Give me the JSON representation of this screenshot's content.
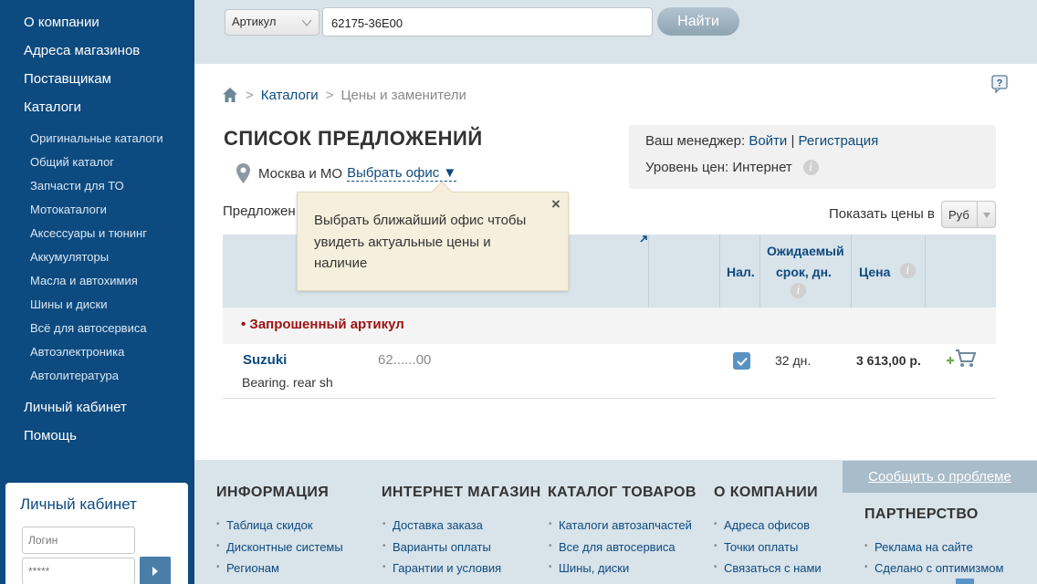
{
  "sidebar": {
    "main_top": [
      "О компании",
      "Адреса магазинов",
      "Поставщикам",
      "Каталоги"
    ],
    "sub": [
      "Оригинальные каталоги",
      "Общий каталог",
      "Запчасти для ТО",
      "Мотокаталоги",
      "Аксессуары и тюнинг",
      "Аккумуляторы",
      "Масла и автохимия",
      "Шины и диски",
      "Всё для автосервиса",
      "Автоэлектроника",
      "Автолитература"
    ],
    "main_bottom": [
      "Личный кабинет",
      "Помощь"
    ],
    "login": {
      "title": "Личный кабинет",
      "login_placeholder": "Логин",
      "password_placeholder": "*****"
    }
  },
  "search": {
    "type_value": "Артикул",
    "query": "62175-36E00",
    "button": "Найти"
  },
  "breadcrumb": {
    "catalogs": "Каталоги",
    "current": "Цены и заменители"
  },
  "page_title": "СПИСОК ПРЕДЛОЖЕНИЙ",
  "location": {
    "city": "Москва и МО",
    "choose_office": "Выбрать офис ▼"
  },
  "manager": {
    "label": "Ваш менеджер:",
    "login": "Войти",
    "sep": "|",
    "register": "Регистрация",
    "price_level_label": "Уровень цен: Интернет"
  },
  "offers_label": "Предложен",
  "show_prices_label": "Показать цены в",
  "currency_value": "Руб",
  "table": {
    "headers": {
      "avail": "Нал.",
      "expected": "Ожидаемый",
      "term": "срок, дн.",
      "price": "Цена"
    },
    "requested_label": "• Запрошенный артикул",
    "row": {
      "brand": "Suzuki",
      "description": "Bearing. rear sh",
      "article": "62......00",
      "days": "32 дн.",
      "price": "3 613,00 р."
    }
  },
  "tooltip": {
    "text": "Выбрать ближайший офис чтобы увидеть актуальные цены и наличие",
    "close": "×"
  },
  "footer": {
    "columns": [
      {
        "title": "ИНФОРМАЦИЯ",
        "links": [
          "Таблица скидок",
          "Дисконтные системы",
          "Регионам"
        ]
      },
      {
        "title": "ИНТЕРНЕТ МАГАЗИН",
        "links": [
          "Доставка заказа",
          "Варианты оплаты",
          "Гарантии и условия"
        ]
      },
      {
        "title": "КАТАЛОГ ТОВАРОВ",
        "links": [
          "Каталоги автозапчастей",
          "Все для автосервиса",
          "Шины, диски"
        ]
      },
      {
        "title": "О КОМПАНИИ",
        "links": [
          "Адреса офисов",
          "Точки оплаты",
          "Связаться с нами"
        ]
      }
    ],
    "report": "Сообщить о проблеме",
    "partner_title": "ПАРТНЕРСТВО",
    "partner_links": [
      "Реклама на сайте",
      "Сделано с оптимизмом"
    ]
  },
  "colors": {
    "sidebar": "#0d4a7f",
    "accent_blue": "#0d4a7f",
    "requested_red": "#9d1212",
    "header_bg": "#d8e3ea",
    "tooltip_bg": "#f6efdd"
  }
}
